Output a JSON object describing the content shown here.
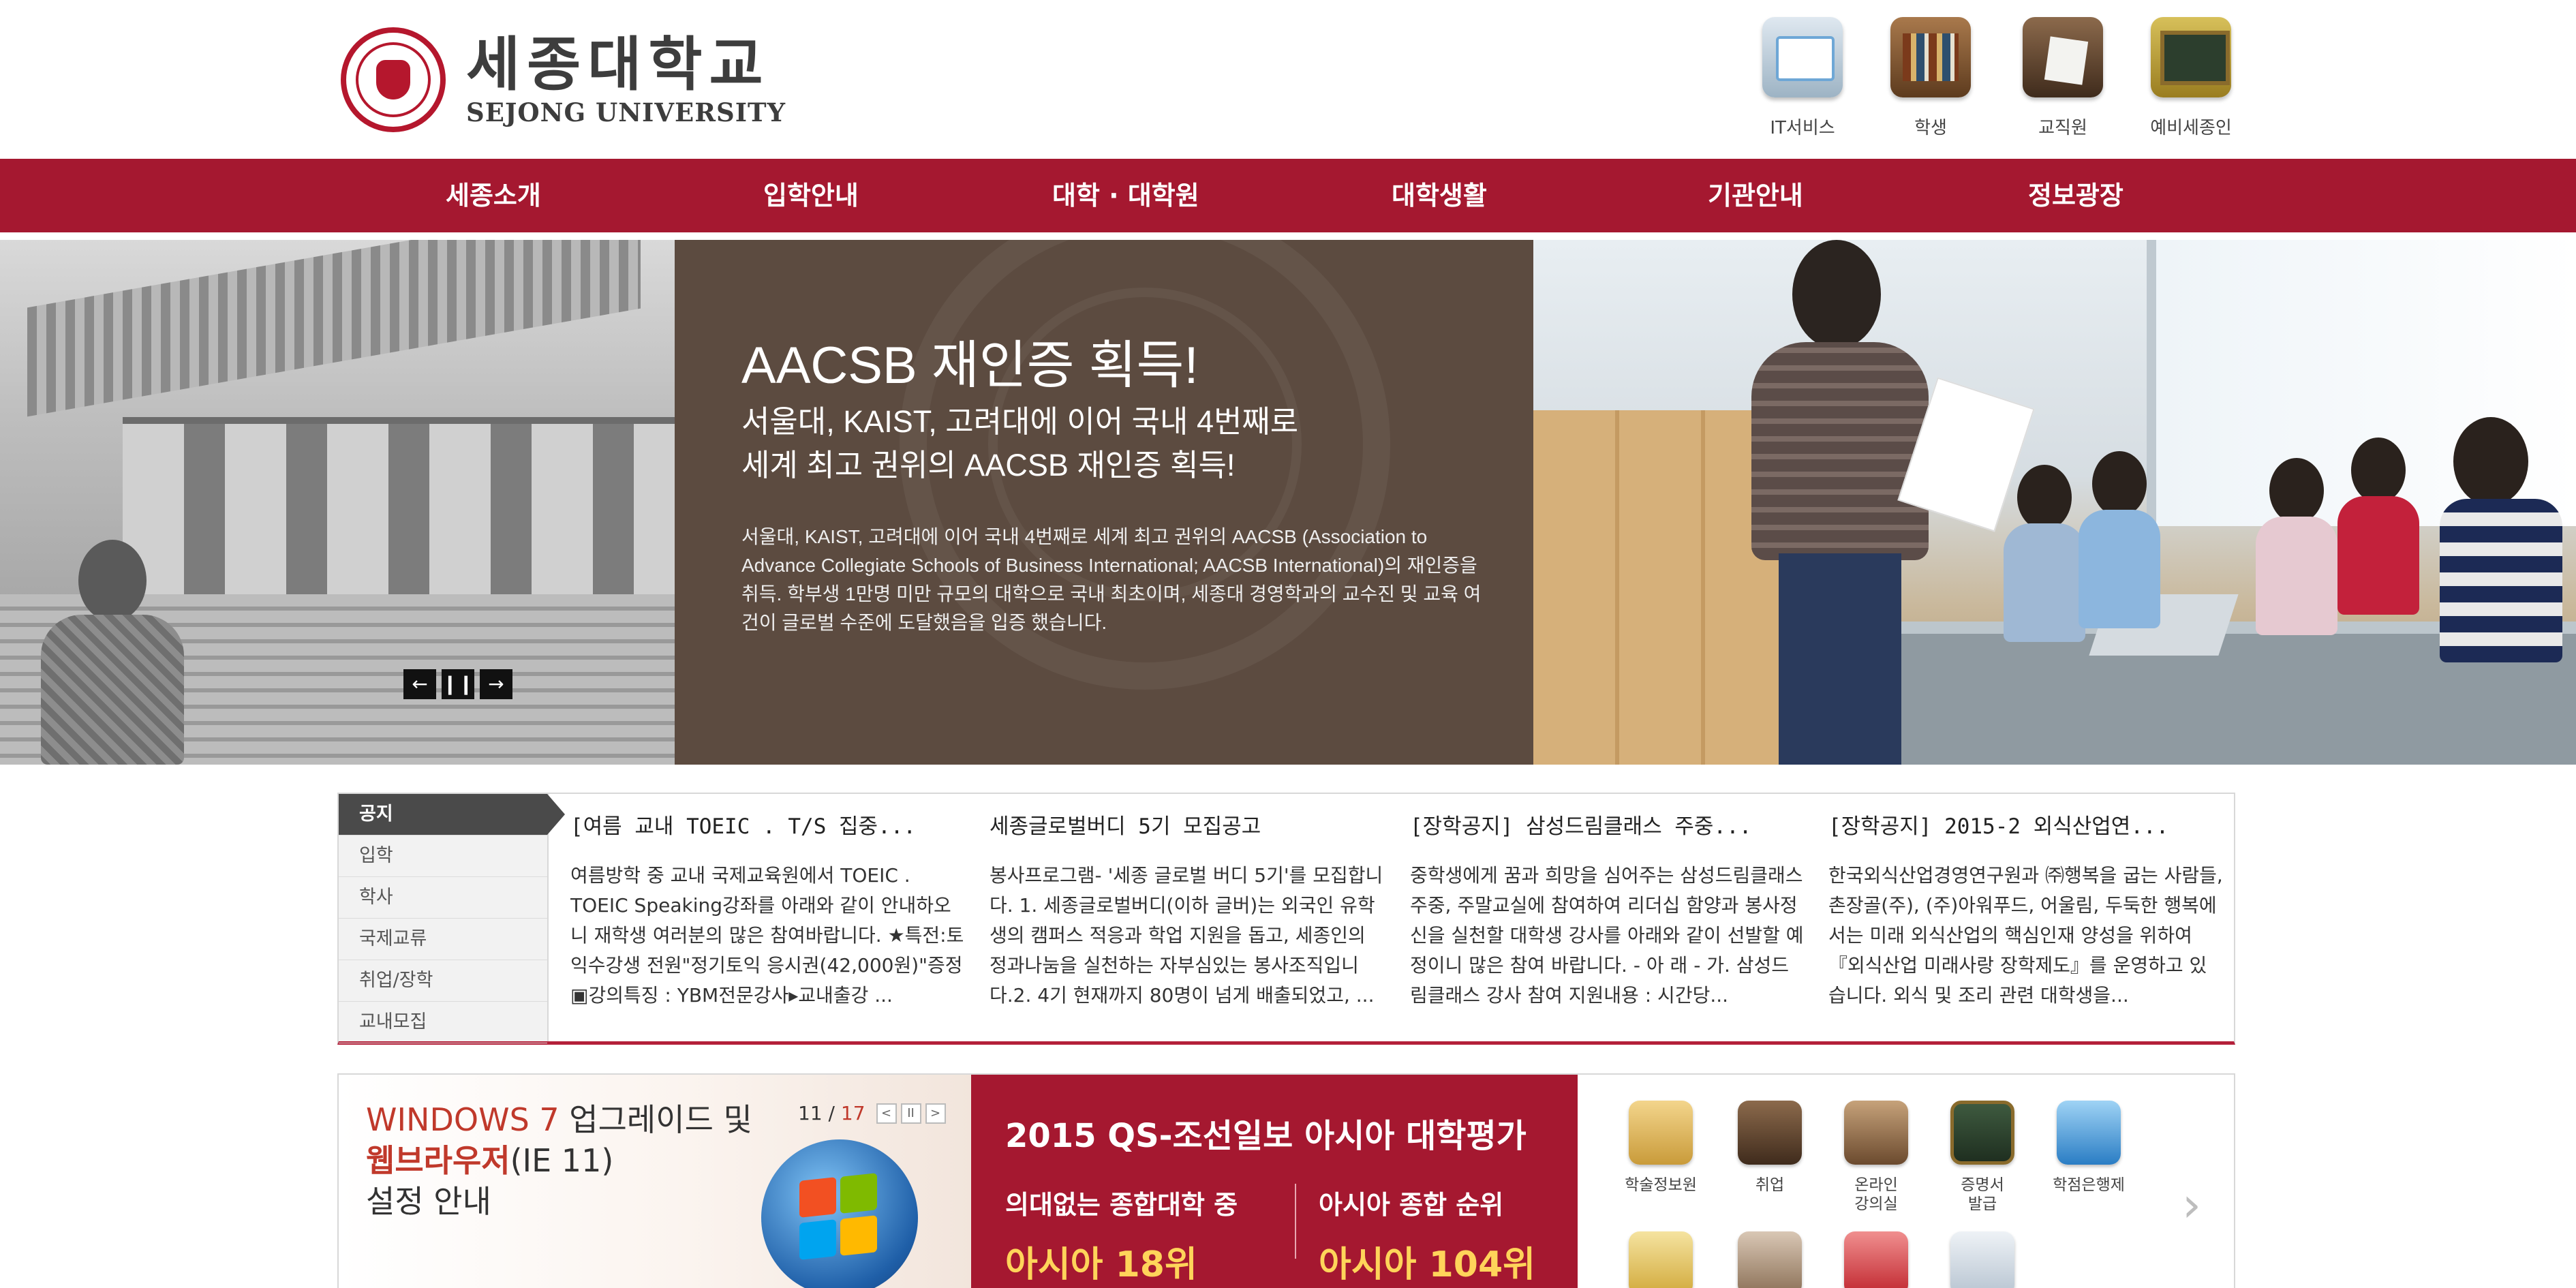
{
  "logo": {
    "name_ko": "세종대학교",
    "name_en": "SEJONG UNIVERSITY"
  },
  "quick_links": [
    {
      "label": "IT서비스",
      "icon": "monitor-chat-icon"
    },
    {
      "label": "학생",
      "icon": "bookshelf-icon"
    },
    {
      "label": "교직원",
      "icon": "briefcase-icon"
    },
    {
      "label": "예비세종인",
      "icon": "blackboard-icon"
    }
  ],
  "nav": [
    {
      "label": "세종소개"
    },
    {
      "label": "입학안내"
    },
    {
      "label": "대학 · 대학원"
    },
    {
      "label": "대학생활"
    },
    {
      "label": "기관안내"
    },
    {
      "label": "정보광장"
    }
  ],
  "banner": {
    "title": "AACSB 재인증 획득!",
    "subtitle_1": "서울대, KAIST, 고려대에 이어 국내 4번째로",
    "subtitle_2": "세계 최고 권위의 AACSB 재인증 획득!",
    "body": "서울대, KAIST, 고려대에 이어 국내 4번째로 세계 최고 권위의 AACSB (Association to Advance Collegiate Schools of Business International; AACSB International)의 재인증을 취득. 학부생 1만명 미만 규모의 대학으로 국내 최초이며, 세종대 경영학과의 교수진 및 교육 여건이 글로벌 수준에 도달했음을 입증 했습니다.",
    "controls": {
      "prev": "←",
      "pause": "❙❙",
      "next": "→"
    }
  },
  "notice": {
    "tabs": [
      "공지",
      "입학",
      "학사",
      "국제교류",
      "취업/장학",
      "교내모집"
    ],
    "items": [
      {
        "title": "[여름 교내 TOEIC . T/S 집중...",
        "desc": "여름방학 중 교내 국제교육원에서 TOEIC . TOEIC Speaking강좌를 아래와 같이 안내하오니 재학생 여러분의 많은 참여바랍니다. ★특전:토익수강생 전원\"정기토익 응시권(42,000원)\"증정 ▣강의특징 : YBM전문강사▸교내출강 ..."
      },
      {
        "title": "세종글로벌버디 5기 모집공고",
        "desc": "봉사프로그램- '세종 글로벌 버디 5기'를 모집합니다. 1. 세종글로벌버디(이하 글버)는 외국인 유학생의 캠퍼스 적응과 학업 지원을 돕고, 세종인의 정과나눔을 실천하는 자부심있는 봉사조직입니다.2. 4기 현재까지 80명이 넘게 배출되었고, ..."
      },
      {
        "title": "[장학공지] 삼성드림클래스 주중...",
        "desc": "중학생에게 꿈과 희망을 심어주는 삼성드림클래스 주중, 주말교실에 참여하여 리더십 함양과 봉사정신을 실천할 대학생 강사를 아래와 같이 선발할 예정이니 많은 참여 바랍니다. - 아 래 - 가. 삼성드림클래스 강사 참여 지원내용 : 시간당..."
      },
      {
        "title": "[장학공지] 2015-2 외식산업연...",
        "desc": "한국외식산업경영연구원과 ㈜행복을 굽는 사람들, 촌장골(주), (주)아워푸드, 어울림, 두둑한 행복에서는 미래 외식산업의 핵심인재 양성을 위하여『외식산업 미래사랑 장학제도』를 운영하고 있습니다. 외식 및 조리 관련 대학생을..."
      }
    ]
  },
  "windows_promo": {
    "line1_red": "WINDOWS 7",
    "line1_rest": " 업그레이드 및",
    "line2_red": "웹브라우저",
    "line2_rest": "(IE 11)",
    "line3": "설정 안내",
    "page_current": "11",
    "page_sep": " / ",
    "page_total": "17",
    "btn_prev": "<",
    "btn_pause": "II",
    "btn_next": ">"
  },
  "qs_promo": {
    "title": "2015 QS-조선일보  아시아 대학평가",
    "left_label": "의대없는 종합대학 중",
    "left_value": "아시아 18위",
    "right_label": "아시아 종합 순위",
    "right_value": "아시아 104위"
  },
  "services": [
    {
      "label": "학술정보원",
      "icon": "id-card-icon"
    },
    {
      "label": "취업",
      "icon": "briefcase-icon"
    },
    {
      "label": "온라인\n강의실",
      "icon": "projector-icon"
    },
    {
      "label": "증명서\n발급",
      "icon": "blackboard-icon"
    },
    {
      "label": "학점은행제",
      "icon": "badge-icon"
    },
    {
      "label": "",
      "icon": "medal-icon"
    },
    {
      "label": "",
      "icon": "magnifier-doc-icon"
    },
    {
      "label": "",
      "icon": "alarm-clock-icon"
    },
    {
      "label": "",
      "icon": "news-icon"
    }
  ],
  "services_next": "›",
  "colors": {
    "brand_red": "#a51830",
    "banner_brown": "#5c4b40",
    "qs_yellow": "#ffd45a"
  }
}
